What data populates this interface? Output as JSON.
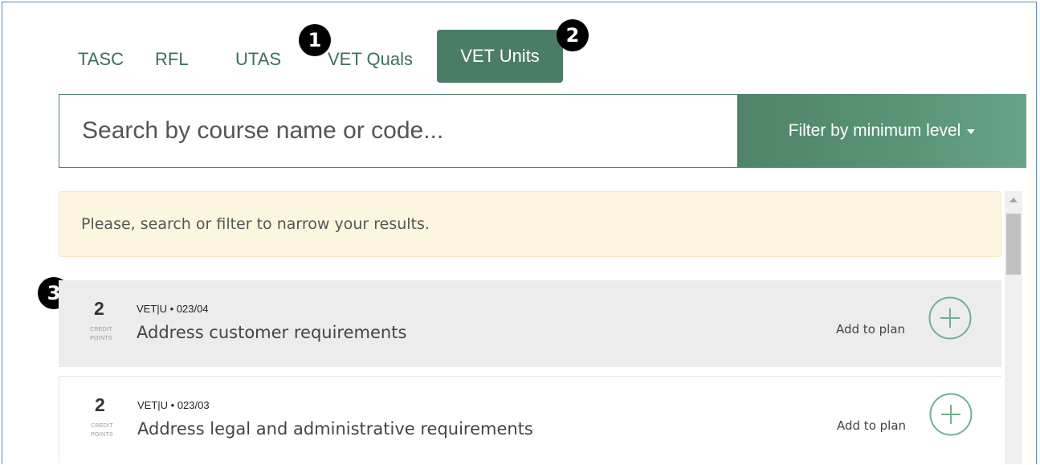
{
  "tabs": [
    {
      "label": "TASC"
    },
    {
      "label": "RFL"
    },
    {
      "label": "UTAS"
    },
    {
      "label": "VET Quals"
    },
    {
      "label": "VET Units",
      "active": true
    }
  ],
  "markers": [
    "1",
    "2",
    "3"
  ],
  "search": {
    "placeholder": "Search by course name or code...",
    "value": ""
  },
  "filter": {
    "label": "Filter by minimum level"
  },
  "notice": "Please, search or filter to narrow your results.",
  "units": [
    {
      "credits": "2",
      "credits_label": "CREDIT POINTS",
      "code": "VET|U • 023/04",
      "title": "Address customer requirements",
      "action": "Add to plan"
    },
    {
      "credits": "2",
      "credits_label": "CREDIT POINTS",
      "code": "VET|U • 023/03",
      "title": "Address legal and administrative requirements",
      "action": "Add to plan"
    }
  ],
  "colors": {
    "accent": "#4a7d65",
    "tab_text": "#3d6f5a",
    "notice_bg": "#fcf6e0",
    "add_icon": "#6fb090"
  },
  "icons": {
    "filter_caret": "caret-down-icon",
    "add": "plus-circle-icon"
  }
}
